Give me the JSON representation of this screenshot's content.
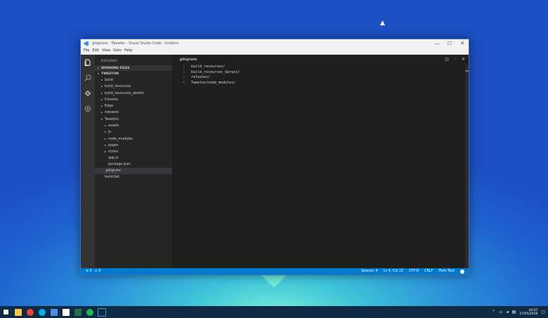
{
  "window": {
    "title": "gitignore - Tweeter - Visual Studio Code - Insiders",
    "controls": {
      "minimize": "—",
      "maximize": "☐",
      "close": "✕"
    }
  },
  "menu": [
    "File",
    "Edit",
    "View",
    "Goto",
    "Help"
  ],
  "activity_bar": [
    "files-icon",
    "search-icon",
    "git-icon",
    "debug-icon"
  ],
  "explorer": {
    "title": "EXPLORER",
    "working_files": "WORKING FILES",
    "project": "TWEETON",
    "tree": [
      {
        "label": "build",
        "kind": "folder",
        "depth": 0
      },
      {
        "label": "build_resources",
        "kind": "folder",
        "depth": 0
      },
      {
        "label": "build_resources_darwin",
        "kind": "folder",
        "depth": 0
      },
      {
        "label": "Chrome",
        "kind": "folder",
        "depth": 0
      },
      {
        "label": "Edge",
        "kind": "folder",
        "depth": 0
      },
      {
        "label": "releases",
        "kind": "folder",
        "depth": 0
      },
      {
        "label": "Tweeton",
        "kind": "folder-open",
        "depth": 0
      },
      {
        "label": "assets",
        "kind": "folder",
        "depth": 1
      },
      {
        "label": "js",
        "kind": "folder",
        "depth": 1
      },
      {
        "label": "node_modules",
        "kind": "folder",
        "depth": 1
      },
      {
        "label": "pages",
        "kind": "folder",
        "depth": 1
      },
      {
        "label": "styles",
        "kind": "folder",
        "depth": 1
      },
      {
        "label": "app.js",
        "kind": "file",
        "depth": 1
      },
      {
        "label": "package.json",
        "kind": "file",
        "depth": 1
      },
      {
        "label": ".gitignore",
        "kind": "file",
        "depth": 0,
        "selected": true
      },
      {
        "label": "build.bat",
        "kind": "file",
        "depth": 0
      }
    ]
  },
  "editor": {
    "tab": ".gitignore",
    "lines": [
      {
        "n": "1",
        "text": "build_resources/"
      },
      {
        "n": "2",
        "text": "build_resources_darwin/"
      },
      {
        "n": "3",
        "text": "releases/"
      },
      {
        "n": "4",
        "text": "Tweeton/node_modules/"
      }
    ],
    "actions": [
      "split-editor-icon",
      "more-icon",
      "close-icon"
    ]
  },
  "statusbar": {
    "errors": "⊗ 0",
    "warnings": "⚠ 0",
    "spaces": "Spaces: 4",
    "position": "Ln 4, Col 22",
    "encoding": "UTF-8",
    "eol": "CRLF",
    "language": "Plain Text"
  },
  "taskbar": {
    "icons": [
      {
        "name": "start-icon",
        "color": "#ffffff"
      },
      {
        "name": "file-explorer-icon",
        "color": "#f5c84a"
      },
      {
        "name": "chrome-icon",
        "color": "#e8453c"
      },
      {
        "name": "skype-icon",
        "color": "#00aff0"
      },
      {
        "name": "store-icon",
        "color": "#4a8fe0"
      },
      {
        "name": "settings-icon",
        "color": "#ffffff"
      },
      {
        "name": "excel-icon",
        "color": "#217346"
      },
      {
        "name": "spotify-icon",
        "color": "#1db954"
      },
      {
        "name": "vscode-icon",
        "color": "#2c9cda"
      }
    ],
    "clock_time": "16:07",
    "clock_date": "27/05/2016"
  },
  "colors": {
    "accent": "#007acc",
    "editor_bg": "#1e1e1e",
    "sidebar_bg": "#252526",
    "activity_bg": "#333333"
  }
}
